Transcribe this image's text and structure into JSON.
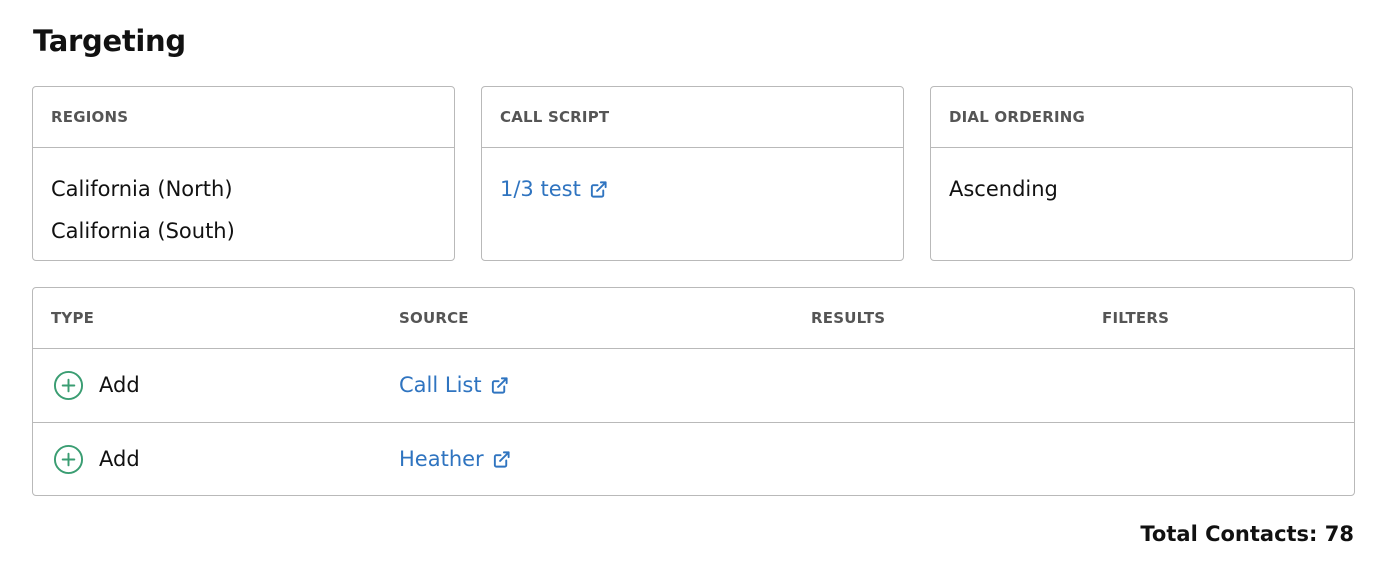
{
  "page": {
    "title": "Targeting"
  },
  "cards": {
    "regions": {
      "header": "REGIONS",
      "items": [
        "California (North)",
        "California (South)"
      ]
    },
    "call_script": {
      "header": "CALL SCRIPT",
      "link_label": "1/3 test",
      "icon": "external-link-icon"
    },
    "dial_ordering": {
      "header": "DIAL ORDERING",
      "value": "Ascending"
    }
  },
  "table": {
    "columns": {
      "type": "TYPE",
      "source": "SOURCE",
      "results": "RESULTS",
      "filters": "FILTERS"
    },
    "rows": [
      {
        "type": "Add",
        "type_icon": "plus-circle-icon",
        "source": "Call List",
        "results": "",
        "filters": ""
      },
      {
        "type": "Add",
        "type_icon": "plus-circle-icon",
        "source": "Heather",
        "results": "",
        "filters": ""
      }
    ]
  },
  "footer": {
    "total_contacts": "Total Contacts: 78"
  },
  "colors": {
    "link": "#2f74c0",
    "add_icon": "#3a9d72",
    "border": "#b9b9b9",
    "header_text": "#555555"
  }
}
